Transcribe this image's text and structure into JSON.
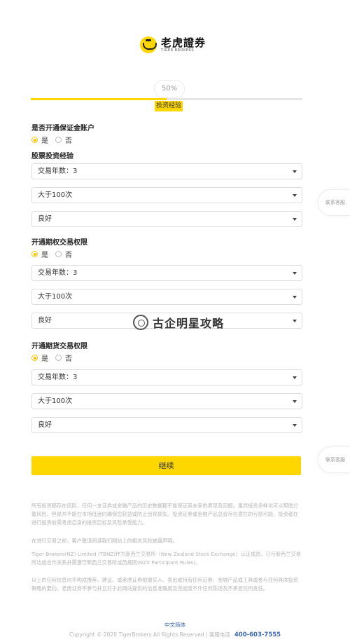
{
  "brand": {
    "name_cn": "老虎證券",
    "name_en": "TIGER BROKERS"
  },
  "progress": {
    "percent_label": "50%",
    "fraction": 0.5,
    "step_label": "投资经验"
  },
  "margin_account": {
    "title": "是否开通保证金账户",
    "options": [
      {
        "label": "是",
        "checked": true
      },
      {
        "label": "否",
        "checked": false
      }
    ]
  },
  "stock": {
    "title": "股票投资经验",
    "years": "交易年数：3",
    "count": "大于100次",
    "knowledge": "良好"
  },
  "options_trading": {
    "title": "开通期权交易权限",
    "options": [
      {
        "label": "是",
        "checked": true
      },
      {
        "label": "否",
        "checked": false
      }
    ],
    "years": "交易年数：3",
    "count": "大于100次",
    "knowledge": "良好"
  },
  "futures_trading": {
    "title": "开通期货交易权限",
    "options": [
      {
        "label": "是",
        "checked": true
      },
      {
        "label": "否",
        "checked": false
      }
    ],
    "years": "交易年数：3",
    "count": "大于100次",
    "knowledge": "良好"
  },
  "contact": {
    "label": "联系客服"
  },
  "watermark": {
    "text": "古企明星攻略"
  },
  "continue_label": "继续",
  "disclaimers": [
    "所有投资都存在风险，任何一支证券或金融产品的历史数据都不能保证其未来的表现及回报。虽然投资多样化可以帮助分散风险，但是并不能在市场低迷时确保您获益或防止出现损失。投资证券或金融产品总会存在潜在的亏损可能，投资者在进行投资前需考虑自身的投资目标及风险承受能力。",
    "在进行交易之前，客户敬请阅读我们网站上的相关风险披露声明。",
    "Tiger Brokers(NZ) Limited (TBNZ)作为新西兰交易所（New Zealand Stock Exchange）认证成员，已与新西兰交易所达成合作关系并需遵守新西兰交易所成员规则(NZX Participant Rules)。",
    "以上的任何信息均不构成推荐、建议、或老虎证券拍摄买入、卖出或持有任何证券、金融产品或工具或参与任何具体投资策略的要约。老虎证券不参与并且对于此网站提供的信息准确度及完成度不作任何陈述及不承担任何责任。"
  ],
  "footer": {
    "language": "中文简体",
    "copyright": "Copyright © 2020 TigerBrokers All Rights Reserved | 客服电话",
    "phone": "400-603-7555"
  }
}
